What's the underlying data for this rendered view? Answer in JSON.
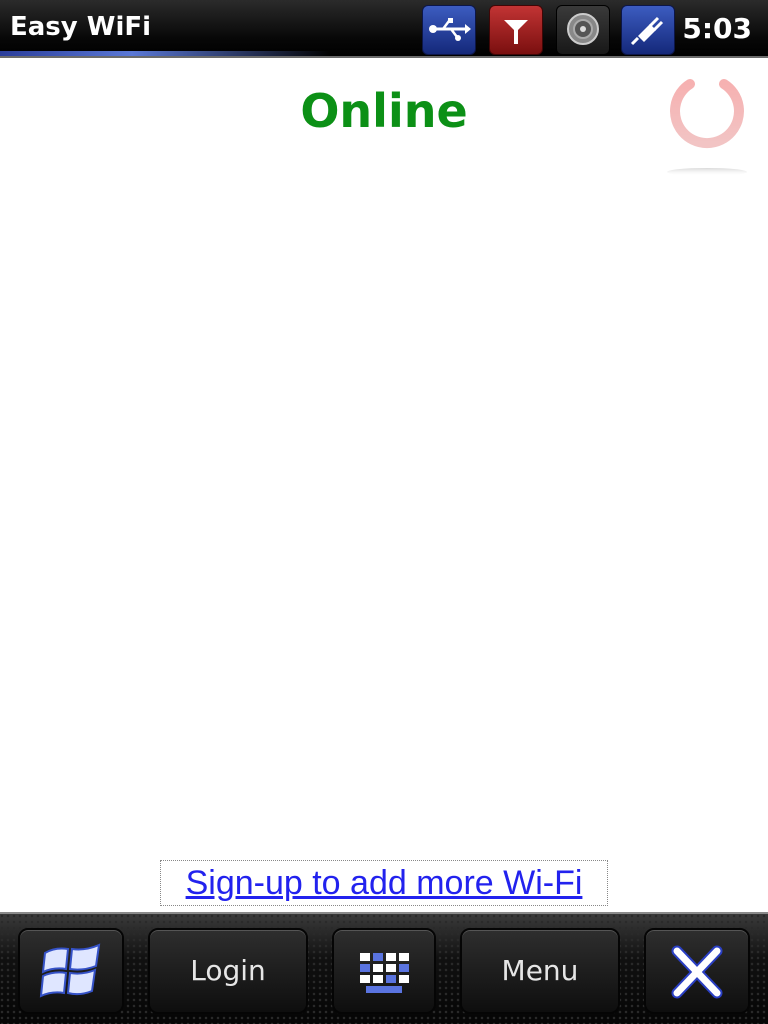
{
  "statusbar": {
    "app_title": "Easy WiFi",
    "clock": "5:03",
    "icons": [
      "usb-icon",
      "signal-antenna-icon",
      "volume-icon",
      "power-plug-icon"
    ]
  },
  "main": {
    "status": "Online",
    "status_color": "#0c9016",
    "power_icon": "power-icon",
    "signup_link": "Sign-up to add more Wi-Fi",
    "link_color": "#2222ee"
  },
  "softkeys": {
    "start_icon": "windows-start-icon",
    "login_label": "Login",
    "keyboard_icon": "keyboard-icon",
    "menu_label": "Menu",
    "close_icon": "close-icon"
  },
  "colors": {
    "accent_blue": "#2a3d9a",
    "signal_red": "#a01e1e"
  }
}
